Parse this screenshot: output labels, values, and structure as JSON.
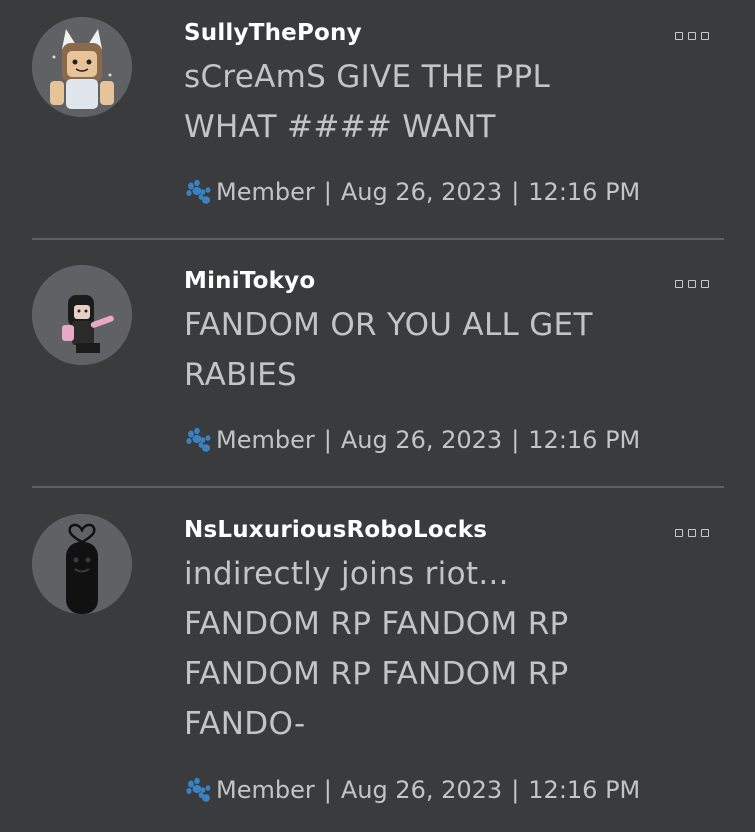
{
  "posts": [
    {
      "username": "SullyThePony",
      "message_lines": [
        "sCreAmS GIVE THE PPL",
        "WHAT #### WANT"
      ],
      "role": "Member",
      "date": "Aug 26, 2023",
      "time": "12:16 PM",
      "separator": "|",
      "avatar_icon": "avatar-pony-girl"
    },
    {
      "username": "MiniTokyo",
      "message_lines": [
        "FANDOM OR YOU ALL GET",
        "RABIES"
      ],
      "role": "Member",
      "date": "Aug 26, 2023",
      "time": "12:16 PM",
      "separator": "|",
      "avatar_icon": "avatar-dark-hair-pink"
    },
    {
      "username": "NsLuxuriousRoboLocks",
      "message_lines": [
        "indirectly joins riot...",
        "FANDOM RP FANDOM RP",
        "FANDOM RP FANDOM RP",
        "FANDO-"
      ],
      "role": "Member",
      "date": "Aug 26, 2023",
      "time": "12:16 PM",
      "separator": "|",
      "avatar_icon": "avatar-heart-shadow"
    }
  ],
  "colors": {
    "background": "#393b3d",
    "username": "#ffffff",
    "text": "#c2c4c6",
    "divider": "#5d5f62",
    "paw": "#3b82c4"
  }
}
